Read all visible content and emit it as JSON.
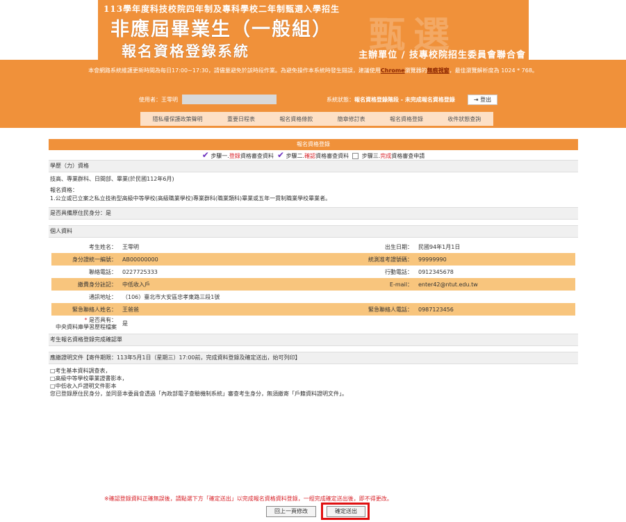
{
  "header": {
    "small_title": "113學年度科技校院四年制及專科學校二年制甄選入學招生",
    "big_title": "非應屆畢業生（一般組）",
    "system_title": "報名資格登錄系統",
    "org": "主辦單位 / 技專校院招生委員會聯合會",
    "watermark": "甄選"
  },
  "notice": {
    "part1": "本會網路系統維護更新時間為每日17:00~17:30，請儘量避免於該時段作業。為避免操作本系統時發生錯誤，建議使用",
    "chrome": "Chrome",
    "part2": "瀏覽器的",
    "incognito": "無痕視窗",
    "part3": "，最佳瀏覽解析度為 1024 * 768。"
  },
  "user": {
    "label": "使用者：王零明",
    "status_label": "系統狀態：",
    "status_value": "報名資格登錄階段 - 未完成報名資格登錄",
    "logout": "登出"
  },
  "nav": [
    "隱私權保護政策聲明",
    "重要日程表",
    "報名資格條款",
    "簡章修訂表",
    "報名資格登錄",
    "收件狀態查詢"
  ],
  "section_title": "報名資格登錄",
  "steps": {
    "s1a": "步驟一.",
    "s1b": "登錄",
    "s1c": "資格審查資料",
    "s2a": "步驟二.",
    "s2b": "確認",
    "s2c": "資格審查資料",
    "s3a": "步驟三.",
    "s3b": "完成",
    "s3c": "資格審查申請"
  },
  "edu": {
    "header": "學歷（力）資格",
    "line1": "技高、專業群科、日間部、畢業(於民國112年6月)",
    "line2": "報名資格：",
    "line3": "1.公立或已立案之私立技術型高級中等學校(高級職業學校)專業群科(職業類科)畢業或五年一貫制職業學校畢業者。"
  },
  "aboriginal": "是否具備原住民身分：是",
  "personal": {
    "header": "個人資料",
    "rows": [
      {
        "l1": "考生姓名：",
        "v1": "王零明",
        "l2": "出生日期：",
        "v2": "民國94年1月1日"
      },
      {
        "l1": "身分證統一編號：",
        "v1": "AB00000000",
        "l2": "統測准考證號碼：",
        "v2": "99999990"
      },
      {
        "l1": "聯絡電話：",
        "v1": "0227725333",
        "l2": "行動電話：",
        "v2": "0912345678"
      },
      {
        "l1": "繳費身分註記：",
        "v1": "中低收入戶",
        "l2": "E-mail：",
        "v2": "enter42@ntut.edu.tw"
      },
      {
        "l1": "通訊地址：",
        "v1": "（106）臺北市大安區忠孝東路三段1號",
        "l2": "",
        "v2": ""
      },
      {
        "l1": "緊急聯絡人姓名：",
        "v1": "王爸爸",
        "l2": "緊急聯絡人電話：",
        "v2": "0987123456"
      }
    ],
    "central_label1": "是否具有：",
    "central_label2": "中央資料庫學習歷程檔案",
    "central_value": "是"
  },
  "confirm_header": "考生報名資格登錄完成確認單",
  "docs": {
    "header": "應繳證明文件【寄件期限：113年5月1日（星期三）17:00前，完成資料登錄及確定送出，始可列印】",
    "items": [
      "□考生基本資料調查表，",
      "□高級中等學校畢業證書影本，",
      "□中低收入戶證明文件影本"
    ],
    "note": "您已登錄原住民身分，並同意本委員會透過「內政部電子查驗機制系統」審查考生身分，無須繳寄「戶籍資料證明文件」。"
  },
  "warning": "※確認登錄資料正確無誤後，請點選下方「確定送出」以完成報名資格資料登錄，一經完成確定送出後，即不得更改。",
  "buttons": {
    "back": "回上一頁修改",
    "submit": "確定送出"
  }
}
